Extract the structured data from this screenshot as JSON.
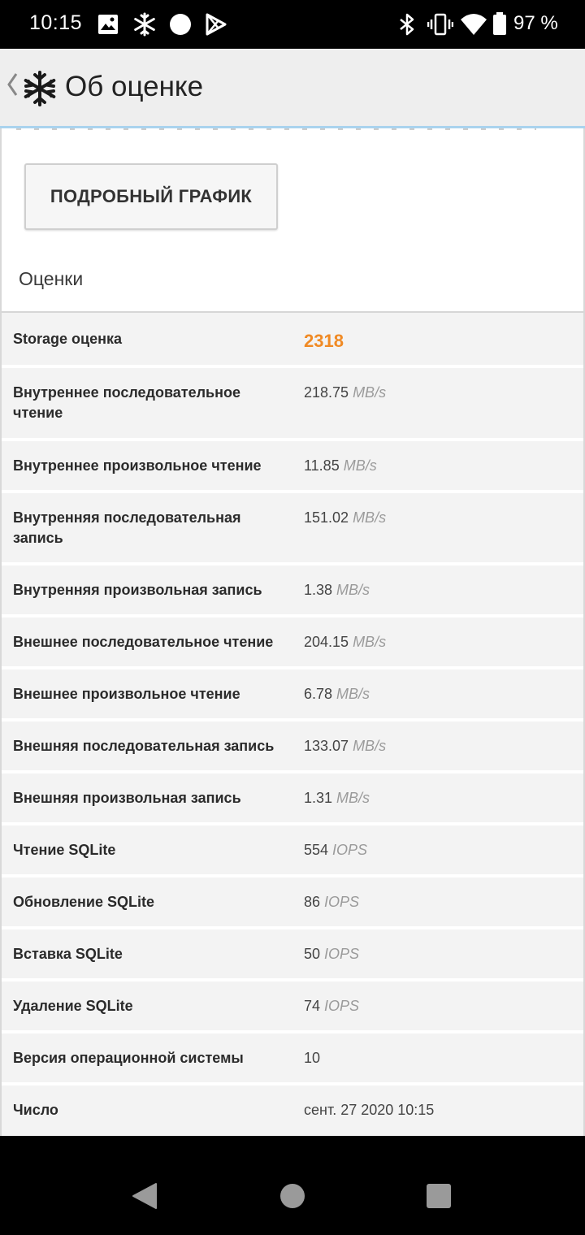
{
  "status_bar": {
    "time": "10:15",
    "battery_text": "97 %",
    "icons": [
      "image-icon",
      "snowflake-icon",
      "circle-icon",
      "play-store-icon",
      "bluetooth-icon",
      "vibrate-icon",
      "wifi-icon",
      "battery-icon"
    ]
  },
  "app_bar": {
    "title": "Об оценке",
    "logo_icon": "snowflake-logo-icon",
    "back_icon": "chevron-left-icon"
  },
  "content": {
    "detail_button_label": "ПОДРОБНЫЙ ГРАФИК",
    "section_title": "Оценки",
    "score_color": "#f08a24",
    "rows": [
      {
        "label": "Storage оценка",
        "value": "2318",
        "unit": ""
      },
      {
        "label": "Внутреннее последовательное чтение",
        "value": "218.75",
        "unit": "MB/s"
      },
      {
        "label": "Внутреннее произвольное чтение",
        "value": "11.85",
        "unit": "MB/s"
      },
      {
        "label": "Внутренняя последовательная запись",
        "value": "151.02",
        "unit": "MB/s"
      },
      {
        "label": "Внутренняя произвольная запись",
        "value": "1.38",
        "unit": "MB/s"
      },
      {
        "label": "Внешнее последовательное чтение",
        "value": "204.15",
        "unit": "MB/s"
      },
      {
        "label": "Внешнее произвольное чтение",
        "value": "6.78",
        "unit": "MB/s"
      },
      {
        "label": "Внешняя последовательная запись",
        "value": "133.07",
        "unit": "MB/s"
      },
      {
        "label": "Внешняя произвольная запись",
        "value": "1.31",
        "unit": "MB/s"
      },
      {
        "label": "Чтение SQLite",
        "value": "554",
        "unit": "IOPS"
      },
      {
        "label": "Обновление SQLite",
        "value": "86",
        "unit": "IOPS"
      },
      {
        "label": "Вставка SQLite",
        "value": "50",
        "unit": "IOPS"
      },
      {
        "label": "Удаление SQLite",
        "value": "74",
        "unit": "IOPS"
      },
      {
        "label": "Версия операционной системы",
        "value": "10",
        "unit": ""
      },
      {
        "label": "Число",
        "value": "сент. 27 2020 10:15",
        "unit": ""
      }
    ]
  },
  "nav_bar": {
    "icons": [
      "back-triangle-icon",
      "home-circle-icon",
      "recents-square-icon"
    ]
  }
}
